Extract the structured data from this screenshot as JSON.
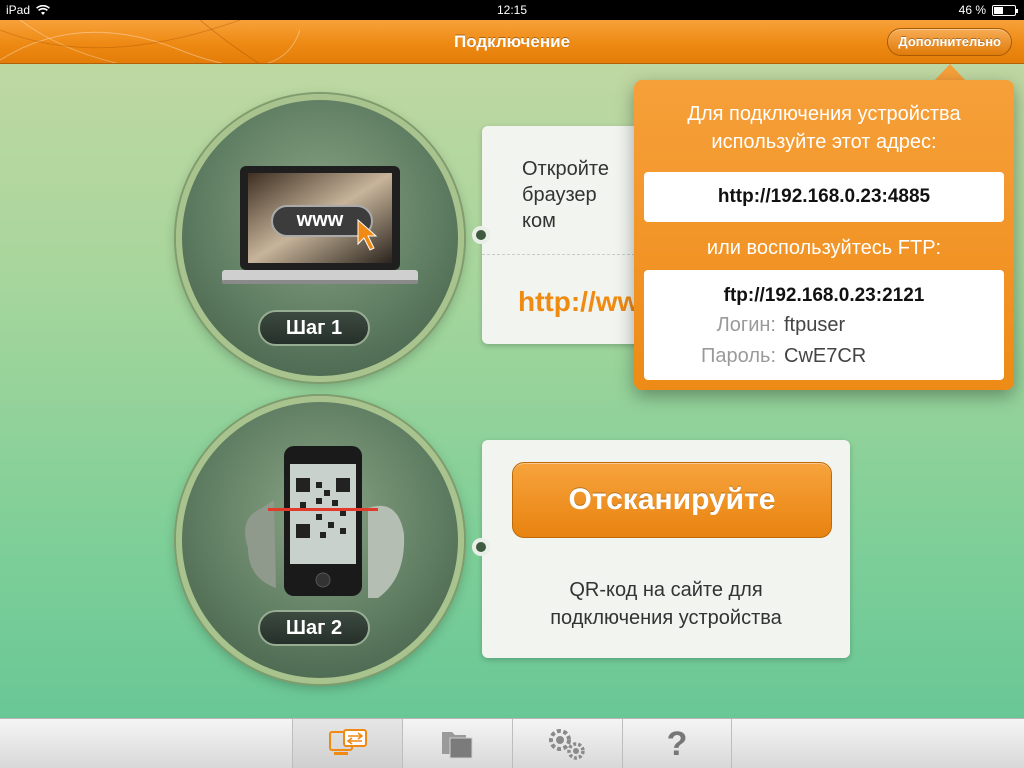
{
  "status_bar": {
    "device": "iPad",
    "time": "12:15",
    "battery": "46 %",
    "battery_level": 0.46
  },
  "nav": {
    "title": "Подключение",
    "more_button": "Дополнительно"
  },
  "step1": {
    "pill": "Шаг 1",
    "www_label": "www",
    "card_text": "Откройте\nбраузер\nком",
    "card_url": "http://ww"
  },
  "step2": {
    "pill": "Шаг 2",
    "scan_button": "Отсканируйте",
    "description": "QR-код на сайте для подключения устройства"
  },
  "popover": {
    "title": "Для подключения устройства используйте этот адрес:",
    "http_address": "http://192.168.0.23:4885",
    "or_text": "или воспользуйтесь FTP:",
    "ftp_address": "ftp://192.168.0.23:2121",
    "login_label": "Логин:",
    "login_value": "ftpuser",
    "password_label": "Пароль:",
    "password_value": "CwE7CR"
  },
  "tabbar": {
    "tabs": [
      {
        "icon": "connection-icon",
        "selected": true
      },
      {
        "icon": "files-icon",
        "selected": false
      },
      {
        "icon": "settings-gears-icon",
        "selected": false
      },
      {
        "icon": "help-icon",
        "selected": false,
        "glyph": "?"
      }
    ]
  },
  "colors": {
    "accent_orange": "#ee8a14",
    "url_orange": "#ef8a12",
    "background_green": "#7fcf98"
  }
}
